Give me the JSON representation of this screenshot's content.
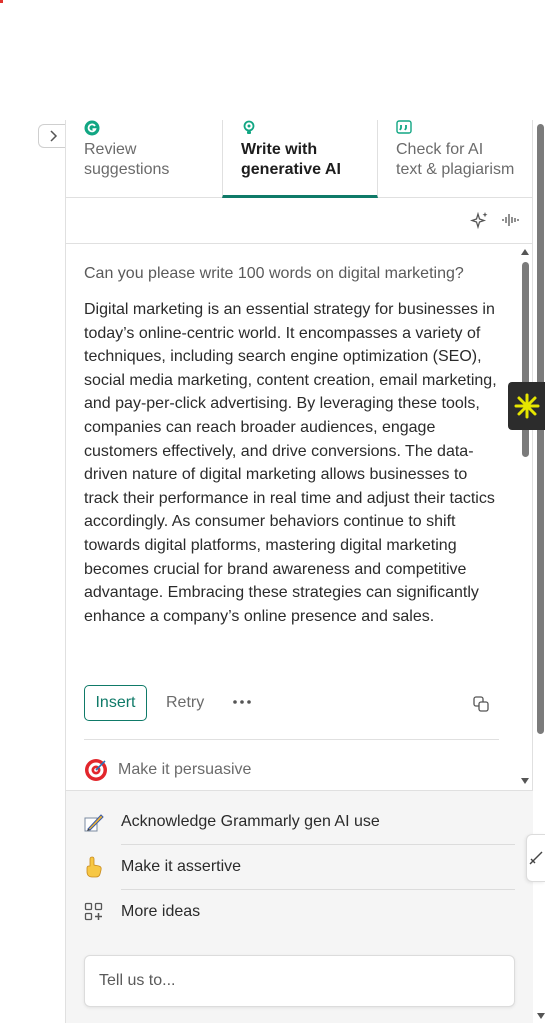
{
  "tabs": [
    {
      "label": "Review\nsuggestions",
      "icon": "grammarly-g-icon",
      "active": false
    },
    {
      "label": "Write with\ngenerative AI",
      "icon": "lightbulb-icon",
      "active": true
    },
    {
      "label": "Check for AI\ntext & plagiarism",
      "icon": "quote-icon",
      "active": false
    }
  ],
  "conversation": {
    "prompt": "Can you please write 100 words on digital marketing?",
    "answer": "Digital marketing is an essential strategy for businesses in today’s online-centric world. It encompasses a variety of techniques, including search engine optimization (SEO), social media marketing, content creation, email marketing, and pay-per-click advertising. By leveraging these tools, companies can reach broader audiences, engage customers effectively, and drive conversions. The data-driven nature of digital marketing allows businesses to track their performance in real time and adjust their tactics accordingly. As consumer behaviors continue to shift towards digital platforms, mastering digital marketing becomes crucial for brand awareness and competitive advantage. Embracing these strategies can significantly enhance a company’s online presence and sales."
  },
  "actions": {
    "insert_label": "Insert",
    "retry_label": "Retry"
  },
  "inline_suggestion": {
    "label": "Make it persuasive",
    "icon": "target-icon"
  },
  "suggestions": [
    {
      "label": "Acknowledge Grammarly gen AI use",
      "icon": "pencil-memo-icon"
    },
    {
      "label": "Make it assertive",
      "icon": "pointing-finger-icon"
    },
    {
      "label": "More ideas",
      "icon": "grid-plus-icon"
    }
  ],
  "input": {
    "placeholder": "Tell us to..."
  },
  "colors": {
    "accent": "#0f7a68",
    "widget_bg": "#2c2c2c",
    "widget_fg": "#e6e600"
  }
}
